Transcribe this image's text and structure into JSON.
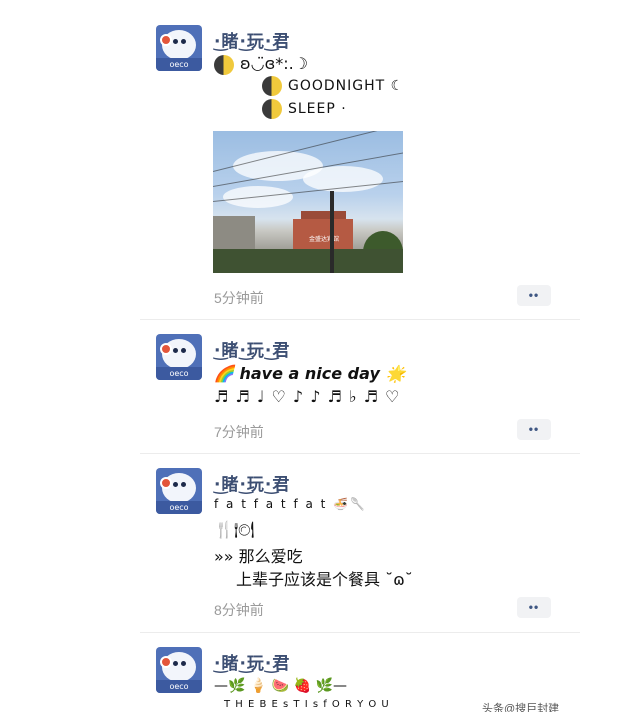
{
  "posts": [
    {
      "author": "·͜睹·͜玩·͜君",
      "avatar_label": "oeco",
      "lines": [
        "ʚ◡̈ɞ*:.☽",
        "GOODNIGHT ☾",
        "SLEEP ·"
      ],
      "time": "5分钟前",
      "more": "••",
      "photo_sign": "金盛达宾馆"
    },
    {
      "author": "·͜睹·͜玩·͜君",
      "avatar_label": "oeco",
      "lines": [
        "🌈 have a nice day 🌟",
        "♬ ♬ ♩ ♡ ♪ ♪ ♬ ♭ ♬ ♡"
      ],
      "time": "7分钟前",
      "more": "••"
    },
    {
      "author": "·͜睹·͜玩·͜君",
      "avatar_label": "oeco",
      "lines": [
        "f a t   f a t   f a t 🍜🥄",
        "🍴🍽",
        "»» 那么爱吃",
        "上辈子应该是个餐具 ˘ɷ˘"
      ],
      "time": "8分钟前",
      "more": "••"
    },
    {
      "author": "·͜睹·͜玩·͜君",
      "avatar_label": "oeco",
      "lines": [
        "—🌿     🍦     🍉     🍓     🌿—",
        "T H E    B E s T    I s    f O R    Y O U"
      ]
    }
  ],
  "watermark": "头条@搜巨封建"
}
